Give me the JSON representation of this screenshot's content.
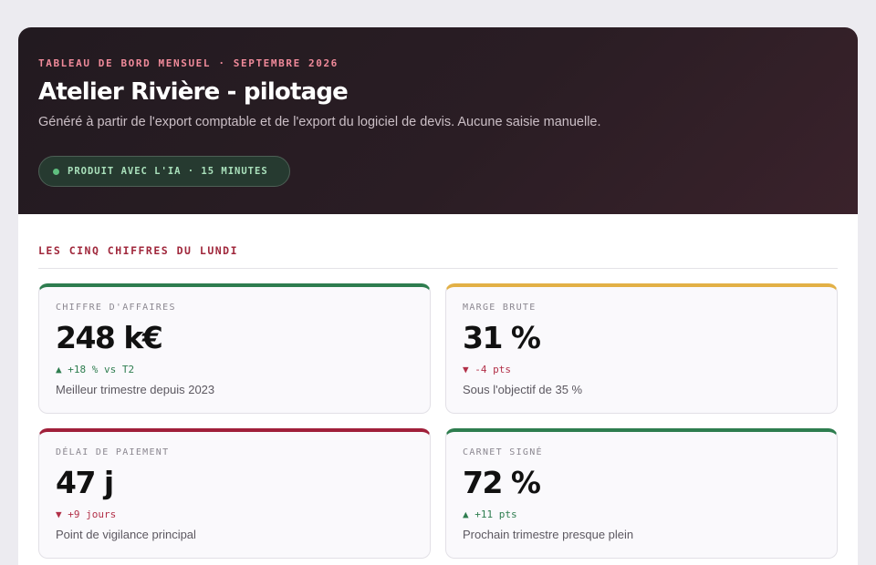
{
  "header": {
    "kicker": "TABLEAU DE BORD MENSUEL · SEPTEMBRE 2026",
    "title": "Atelier Rivière - pilotage",
    "subtitle": "Généré à partir de l'export comptable et de l'export du logiciel de devis. Aucune saisie manuelle.",
    "badge": "PRODUIT AVEC L'IA · 15 MINUTES"
  },
  "section": {
    "title": "LES CINQ CHIFFRES DU LUNDI"
  },
  "kpis": [
    {
      "label": "CHIFFRE D'AFFAIRES",
      "value": "248 k€",
      "trend": "▲ +18 % vs T2",
      "direction": "up",
      "note": "Meilleur trimestre depuis 2023",
      "accent": "#2e7d4f"
    },
    {
      "label": "MARGE BRUTE",
      "value": "31 %",
      "trend": "▼ -4 pts",
      "direction": "down",
      "note": "Sous l'objectif de 35 %",
      "accent": "#e2b046"
    },
    {
      "label": "DÉLAI DE PAIEMENT",
      "value": "47 j",
      "trend": "▼ +9 jours",
      "direction": "down",
      "note": "Point de vigilance principal",
      "accent": "#a01f3a"
    },
    {
      "label": "CARNET SIGNÉ",
      "value": "72 %",
      "trend": "▲ +11 pts",
      "direction": "up",
      "note": "Prochain trimestre presque plein",
      "accent": "#2e7d4f"
    }
  ]
}
